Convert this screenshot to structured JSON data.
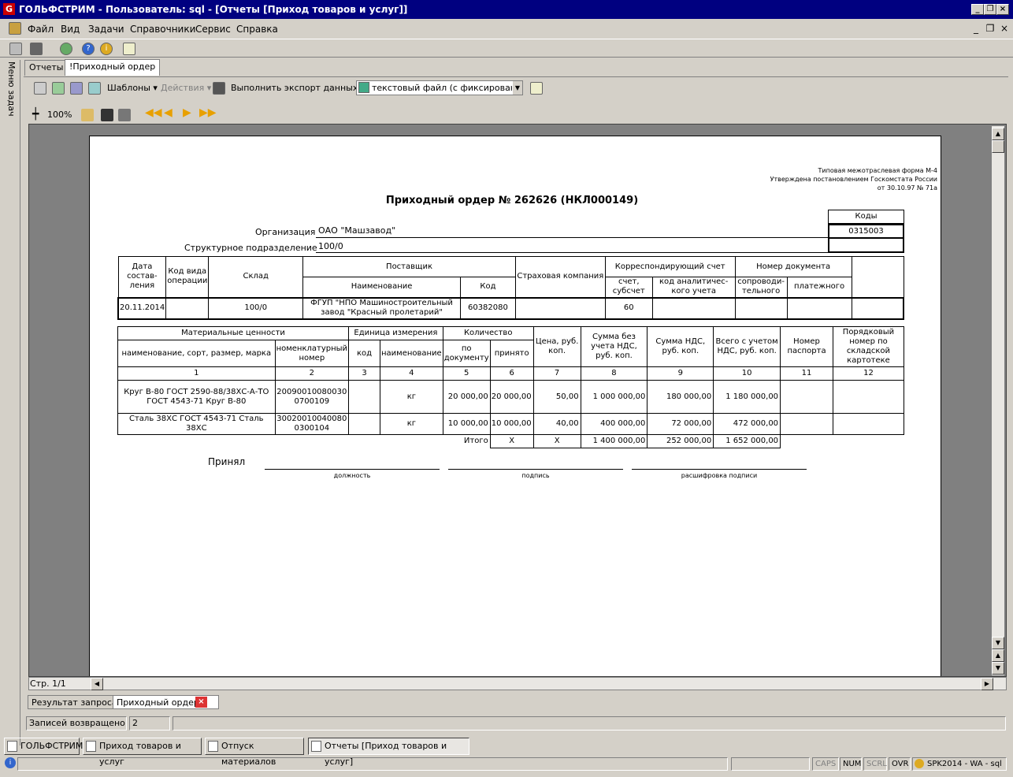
{
  "window": {
    "title": "ГОЛЬФСТРИМ - Пользователь: sql - [Отчеты  [Приход товаров и услуг]]",
    "logo": "G"
  },
  "menu": [
    "Файл",
    "Вид",
    "Задачи",
    "Справочники",
    "Сервис",
    "Справка"
  ],
  "taskpane_label": "Меню задач",
  "tabs": [
    "Отчеты",
    "!Приходный ордер"
  ],
  "toolbar2": {
    "templates": "Шаблоны",
    "actions": "Действия",
    "export_label": "Выполнить экспорт данных в:",
    "export_value": "текстовый файл (с фиксированным"
  },
  "viewer_toolbar": {
    "zoom": "100%"
  },
  "doc": {
    "form_note_1": "Типовая межотраслевая форма М-4",
    "form_note_2": "Утверждена постановлением Госкомстата России",
    "form_note_3": "от 30.10.97 № 71а",
    "title": "Приходный ордер № 262626  (НКЛ000149)",
    "codes_label": "Коды",
    "codes_value": "0315003",
    "org_label": "Организация",
    "org_value": "ОАО \"Машзавод\"",
    "dept_label": "Структурное подразделение",
    "dept_value": "100/0",
    "h1": {
      "date": "Дата состав-ления",
      "op_code": "Код вида операции",
      "warehouse": "Склад",
      "supplier": "Поставщик",
      "supplier_name": "Наименование",
      "supplier_code": "Код",
      "insurance": "Страховая компания",
      "corr": "Корреспондирующий счет",
      "corr_acc": "счет, субсчет",
      "corr_anal": "код аналитичес-кого учета",
      "docnum": "Номер документа",
      "doc_accomp": "сопроводи-тельного",
      "doc_pay": "платежного"
    },
    "r1": {
      "date": "20.11.2014",
      "op_code": "",
      "warehouse": "100/0",
      "supplier_name": "ФГУП \"НПО Машиностроительный завод \"Красный пролетарий\"",
      "supplier_code": "60382080",
      "insurance": "",
      "corr_acc": "60",
      "corr_anal": "",
      "doc_accomp": "",
      "doc_pay": "",
      "extra": ""
    },
    "h2": {
      "mat": "Материальные ценности",
      "mat_name": "наименование, сорт, размер, марка",
      "mat_num": "номенклатурный номер",
      "unit": "Единица измерения",
      "unit_code": "код",
      "unit_name": "наименование",
      "qty": "Количество",
      "qty_doc": "по документу",
      "qty_acc": "принято",
      "price": "Цена, руб. коп.",
      "sum": "Сумма без учета НДС, руб. коп.",
      "vat": "Сумма НДС, руб. коп.",
      "total": "Всего с учетом НДС, руб. коп.",
      "passport": "Номер паспорта",
      "card": "Порядковый номер по складской картотеке"
    },
    "colnums": [
      "1",
      "2",
      "3",
      "4",
      "5",
      "6",
      "7",
      "8",
      "9",
      "10",
      "11",
      "12"
    ],
    "rows": [
      [
        "Круг В-80 ГОСТ 2590-88/38ХС-А-ТО ГОСТ 4543-71 Круг В-80",
        "20090010080030 0700109",
        "",
        "кг",
        "20 000,00",
        "20 000,00",
        "50,00",
        "1 000 000,00",
        "180 000,00",
        "1 180 000,00",
        "",
        ""
      ],
      [
        "Сталь 38ХС ГОСТ 4543-71 Сталь 38ХС",
        "30020010040080 0300104",
        "",
        "кг",
        "10 000,00",
        "10 000,00",
        "40,00",
        "400 000,00",
        "72 000,00",
        "472 000,00",
        "",
        ""
      ]
    ],
    "total": {
      "label": "Итого",
      "qty_acc": "X",
      "price": "X",
      "sum": "1 400 000,00",
      "vat": "252 000,00",
      "total": "1 652 000,00"
    },
    "sign": {
      "label": "Принял",
      "pos": "должность",
      "sig": "подпись",
      "decode": "расшифровка подписи"
    }
  },
  "page_indicator": "Стр. 1/1",
  "bottom_tabs": [
    "Результат запроса",
    "Приходный ордер"
  ],
  "status": {
    "label": "Записей возвращено",
    "value": "2"
  },
  "taskbar": [
    "ГОЛЬФСТРИМ",
    "Приход товаров и услуг",
    "Отпуск материалов",
    "Отчеты  [Приход товаров и услуг]"
  ],
  "indicators": [
    "CAPS",
    "NUM",
    "SCRL",
    "OVR",
    "SPK2014 - WA - sql"
  ]
}
